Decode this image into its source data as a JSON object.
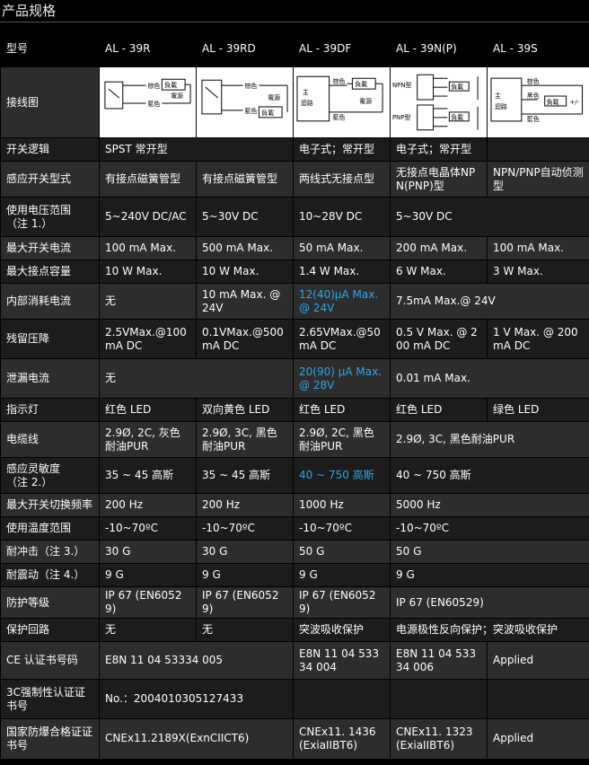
{
  "page_title": "产品规格",
  "models": [
    "AL - 39R",
    "AL - 39RD",
    "AL - 39DF",
    "AL - 39N(P)",
    "AL - 39S"
  ],
  "labels": {
    "model": "型号",
    "wiring": "接线图",
    "logic": "开关逻辑",
    "type": "感应开关型式",
    "voltage_1": "使用电压范围",
    "voltage_2": "（注 1.）",
    "max_current": "最大开关电流",
    "max_capacity": "最大接点容量",
    "internal": "内部消耗电流",
    "residual": "残留压降",
    "leakage": "泄漏电流",
    "indicator": "指示灯",
    "cable": "电缆线",
    "sensitivity_1": "感应灵敏度",
    "sensitivity_2": "（注 2.）",
    "frequency": "最大开关切换频率",
    "temperature": "使用温度范围",
    "shock": "耐冲击（注 3.）",
    "vibration": "耐震动（注 4.）",
    "protection": "防护等级",
    "circuit": "保护回路",
    "ce": "CE 认证书号码",
    "ccc": "3C强制性认证证书号",
    "ex": "国家防爆合格证证书号"
  },
  "diagram": {
    "brown": "棕色",
    "black": "黑色",
    "blue": "藍色",
    "load": "負載",
    "power": "電源",
    "npn": "NPN型",
    "pnp": "PNP型",
    "main": "主",
    "circuit": "迴路",
    "plusminus": "+/-"
  },
  "rows": {
    "logic": {
      "r": "SPST 常开型",
      "df": "电子式；常开型",
      "np": "电子式；常开型"
    },
    "type": {
      "r": "有接点磁簧管型",
      "rd": "有接点磁簧管型",
      "df": "两线式无接点型",
      "np": "无接点电晶体NPN(PNP)型",
      "s": "NPN/PNP自动侦测型"
    },
    "voltage": {
      "r": "5~240V DC/AC",
      "rd": "5~30V DC",
      "df": "10~28V DC",
      "np": "5~30V DC"
    },
    "max_current": {
      "r": "100 mA Max.",
      "rd": "500 mA Max.",
      "df": "50 mA Max.",
      "np": "200 mA Max.",
      "s": "100 mA Max."
    },
    "max_capacity": {
      "r": "10 W Max.",
      "rd": "10 W Max.",
      "df": "1.4 W Max.",
      "np": "6 W Max.",
      "s": "3 W Max."
    },
    "internal": {
      "r": "无",
      "rd": "10 mA Max. @ 24V",
      "df": "12(40)μA Max. @ 24V",
      "np": "7.5mA Max.@ 24V"
    },
    "residual": {
      "r": "2.5VMax.@100mA DC",
      "rd": "0.1VMax.@500mA DC",
      "df": "2.65VMax.@50mA DC",
      "np": "0.5 V Max. @ 200 mA DC",
      "s": "1 V Max. @ 200 mA DC"
    },
    "leakage": {
      "r": "无",
      "df": "20(90) μA Max. @ 28V",
      "np": "0.01 mA Max."
    },
    "indicator": {
      "r": "红色  LED",
      "rd": "双向黄色  LED",
      "df": "红色  LED",
      "np": "红色  LED",
      "s": "绿色  LED"
    },
    "cable": {
      "r": "2.9Ø, 2C, 灰色耐油PUR",
      "rd": "2.9Ø, 3C, 黑色耐油PUR",
      "df": "2.9Ø,  2C,  黑色耐油PUR",
      "np": "2.9Ø, 3C, 黑色耐油PUR"
    },
    "sensitivity": {
      "r": "35 ~ 45 高斯",
      "rd": "35 ~ 45 高斯",
      "df": "40 ~ 750 高斯",
      "np": "40 ~ 750 高斯"
    },
    "frequency": {
      "r": "200 Hz",
      "rd": "200 Hz",
      "df": "1000 Hz",
      "np": "5000 Hz"
    },
    "temperature": {
      "r": "-10~70ºC",
      "rd": "-10~70ºC",
      "df": "-10~70ºC",
      "np": "-10~70ºC"
    },
    "shock": {
      "r": "30 G",
      "rd": "30 G",
      "df": "50 G",
      "np": "50 G"
    },
    "vibration": {
      "r": "9 G",
      "rd": "9 G",
      "df": "9 G",
      "np": "9 G"
    },
    "protection": {
      "r": "IP 67 (EN60529)",
      "rd": "IP 67 (EN60529)",
      "df": "IP 67 (EN60529)",
      "np": "IP 67 (EN60529)"
    },
    "circuit": {
      "r": "无",
      "rd": "无",
      "df": "突波吸收保护",
      "np": "电源极性反向保护；突波吸收保护"
    },
    "ce": {
      "r": "E8N 11 04 53334 005",
      "df": "E8N 11 04 53334 004",
      "np": "E8N 11 04 53334 006",
      "s": "Applied"
    },
    "ccc": {
      "r": "No.：2004010305127433"
    },
    "ex": {
      "r": "CNEx11.2189X(ExnCIICT6)",
      "df": "CNEx11. 1436 (ExiaIIBT6)",
      "np": "CNEx11. 1323 (ExiaIIBT6)",
      "s": "Applied"
    }
  }
}
